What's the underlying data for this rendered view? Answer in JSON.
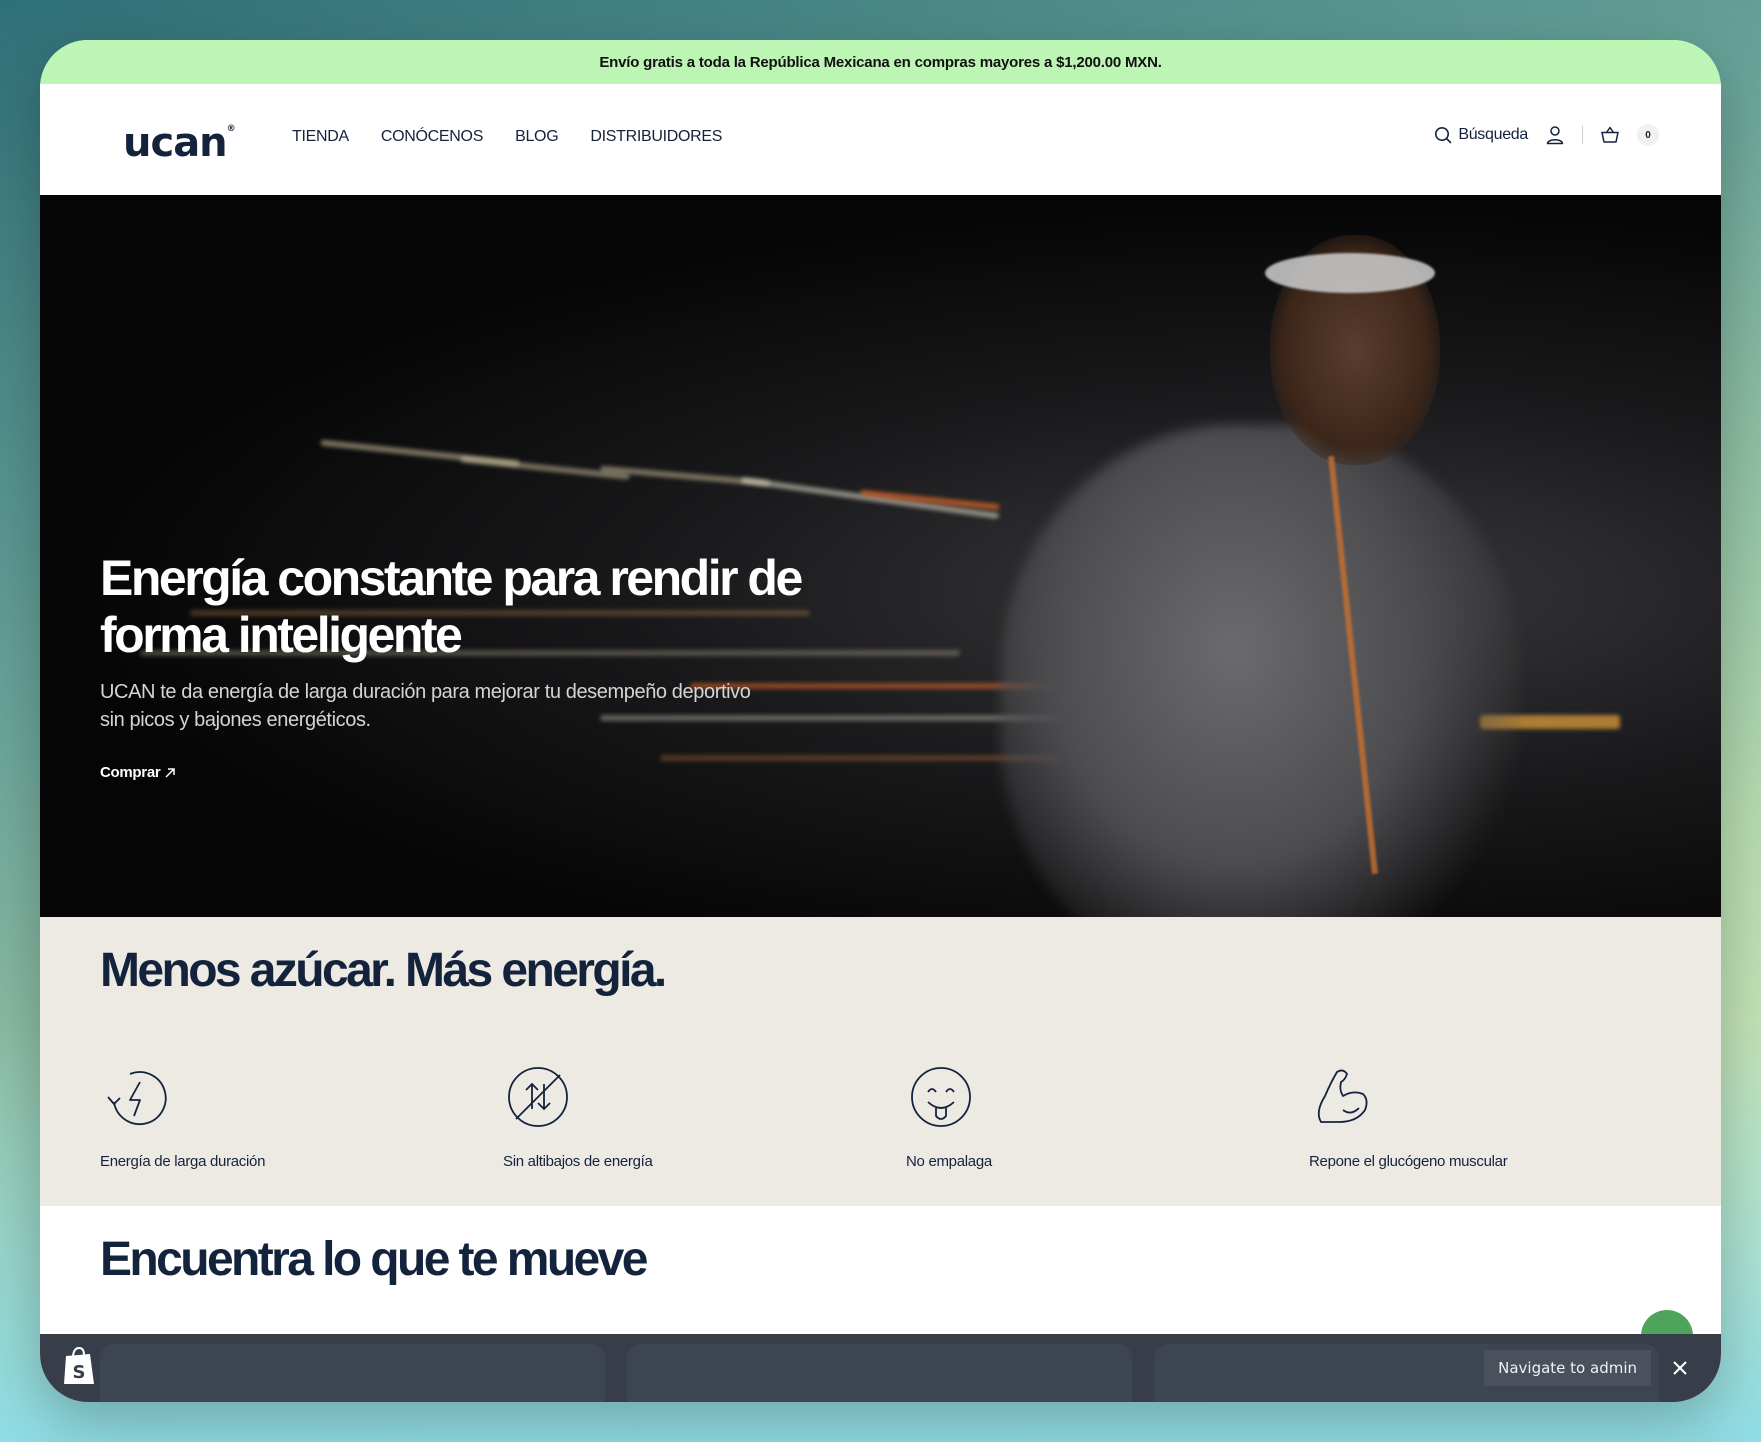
{
  "announcement": {
    "text": "Envío gratis a toda la República Mexicana en compras mayores a $1,200.00 MXN."
  },
  "header": {
    "logo_text": "ucan",
    "nav": [
      "TIENDA",
      "CONÓCENOS",
      "BLOG",
      "DISTRIBUIDORES"
    ],
    "search_label": "Búsqueda",
    "cart_count": "0"
  },
  "hero": {
    "title": "Energía constante para rendir de forma inteligente",
    "subtitle": "UCAN te da energía de larga duración para mejorar tu desempeño deportivo sin picos y bajones energéticos.",
    "cta": "Comprar"
  },
  "benefits": {
    "heading": "Menos azúcar. Más energía.",
    "items": [
      {
        "label": "Energía de larga duración",
        "icon": "energy-cycle-icon"
      },
      {
        "label": "Sin altibajos de energía",
        "icon": "up-down-arrows-icon"
      },
      {
        "label": "No empalaga",
        "icon": "smiley-tongue-icon"
      },
      {
        "label": "Repone el glucógeno muscular",
        "icon": "flexed-arm-icon"
      }
    ]
  },
  "find": {
    "heading": "Encuentra lo que te mueve"
  },
  "admin_bar": {
    "navigate_label": "Navigate to admin"
  },
  "colors": {
    "announcement_bg": "#bdf5b4",
    "brand_navy": "#14233c",
    "benefits_bg": "#edeae4",
    "admin_bar_bg": "#373e4a"
  }
}
